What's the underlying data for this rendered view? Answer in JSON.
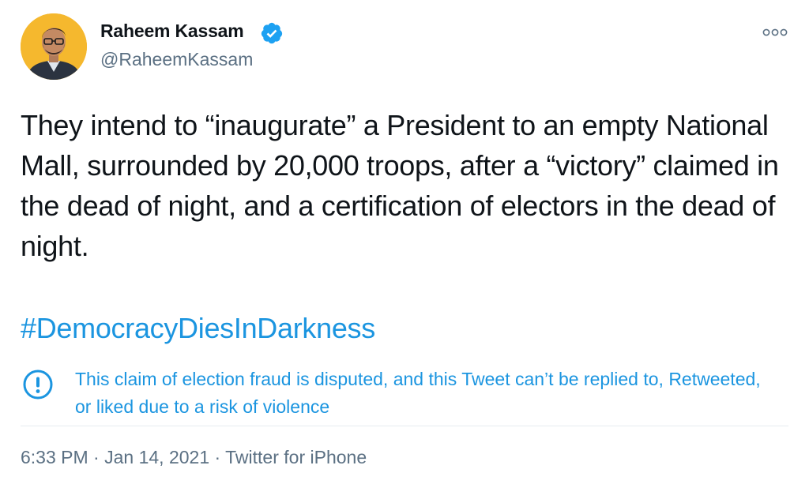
{
  "author": {
    "display_name": "Raheem Kassam",
    "handle": "@RaheemKassam",
    "verified": true,
    "avatar_bg": "#f5b82e"
  },
  "tweet": {
    "text": "They intend to “inaugurate” a President to an empty National Mall, surrounded by 20,000 troops, after a “victory” claimed in the dead of night, and a certification of electors in the dead of night.",
    "hashtag": "#DemocracyDiesInDarkness"
  },
  "notice": {
    "icon": "info-circle-icon",
    "text": "This claim of election fraud is disputed, and this Tweet can’t be replied to, Retweeted, or liked due to a risk of violence"
  },
  "meta": {
    "time": "6:33 PM",
    "separator": " · ",
    "date": "Jan 14, 2021",
    "source": "Twitter for iPhone"
  },
  "colors": {
    "link_blue": "#1b95e0",
    "verified_blue": "#1da1f2",
    "secondary_text": "#5b7083",
    "primary_text": "#0f1419"
  }
}
